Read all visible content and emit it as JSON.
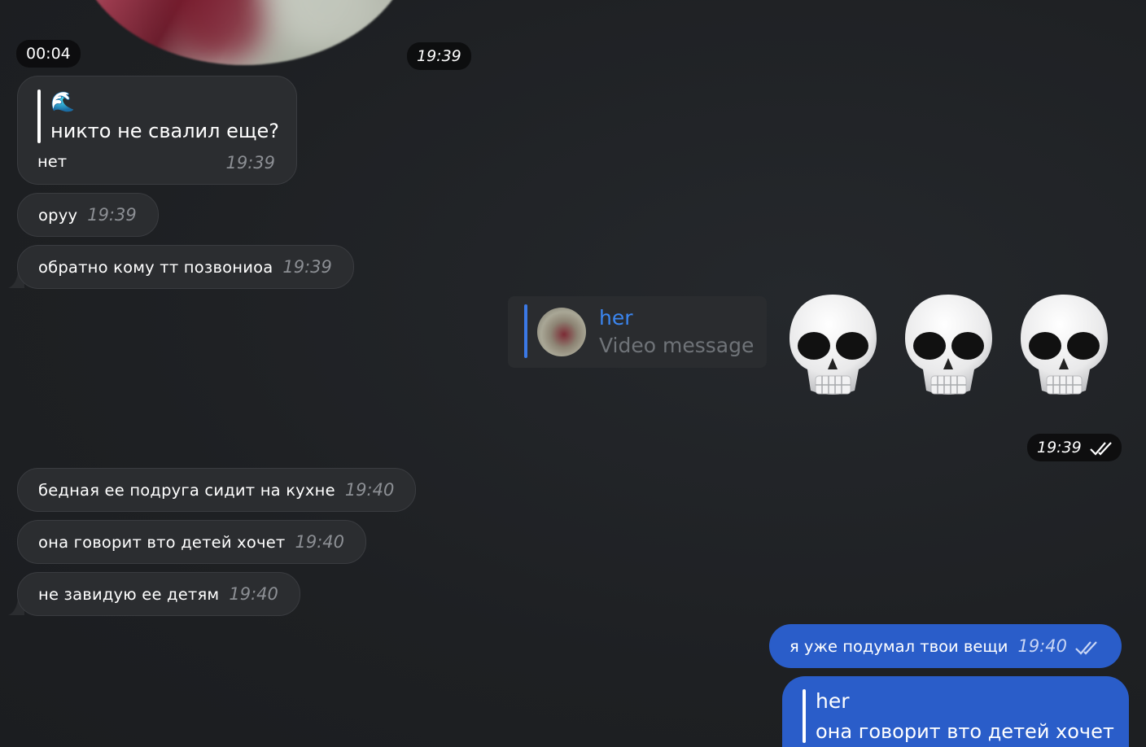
{
  "video_note": {
    "duration": "00:04",
    "time": "19:39"
  },
  "incoming": [
    {
      "quote_emoji": "🌊",
      "quote_text": "никто не свалил еще?",
      "text": "нет",
      "time": "19:39"
    },
    {
      "text": "оруу",
      "time": "19:39"
    },
    {
      "text": "обратно кому тт позвониоа",
      "time": "19:39"
    },
    {
      "text": "бедная ее подруга сидит на кухне",
      "time": "19:40"
    },
    {
      "text": "она говорит вто детей хочет",
      "time": "19:40"
    },
    {
      "text": "не завидую ее детям",
      "time": "19:40"
    }
  ],
  "outgoing_emoji_message": {
    "reply": {
      "name": "her",
      "subtitle": "Video message"
    },
    "emoji": [
      "💀",
      "💀",
      "💀"
    ],
    "time": "19:39"
  },
  "outgoing": [
    {
      "text": "я уже подумал твои вещи",
      "time": "19:40"
    },
    {
      "reply_name": "her",
      "reply_text": "она говорит вто детей хочет"
    }
  ],
  "colors": {
    "background": "#1f2124",
    "incoming_bubble": "#2b2d30",
    "outgoing_bubble": "#2a5dc9",
    "reply_accent": "#3b86f0"
  }
}
